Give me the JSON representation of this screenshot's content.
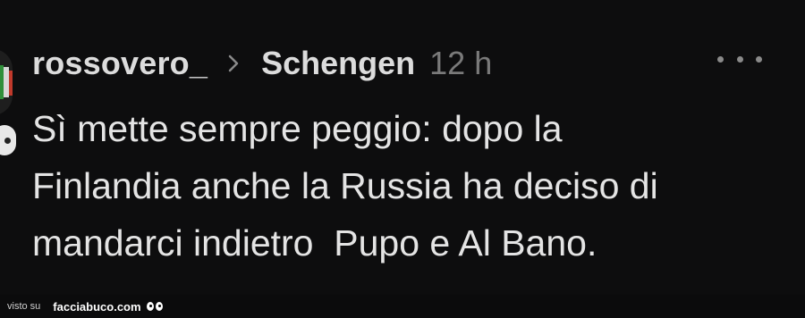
{
  "post": {
    "username": "rossovero_",
    "group": "Schengen",
    "time": "12 h",
    "text": "Sì mette sempre peggio: dopo la\nFinlandia anche la Russia ha deciso di\nmandarci indietro  Pupo e Al Bano."
  },
  "footer": {
    "visto": "visto su",
    "site": "facciabuco.com"
  },
  "icons": {
    "chevron": "chevron-right-icon",
    "more": "more-horizontal-icon",
    "avatar": "avatar",
    "eyes": "eyes-icon"
  },
  "colors": {
    "background": "#0d0d0e",
    "text": "#e4e4e4",
    "muted": "#7a7a7a"
  }
}
